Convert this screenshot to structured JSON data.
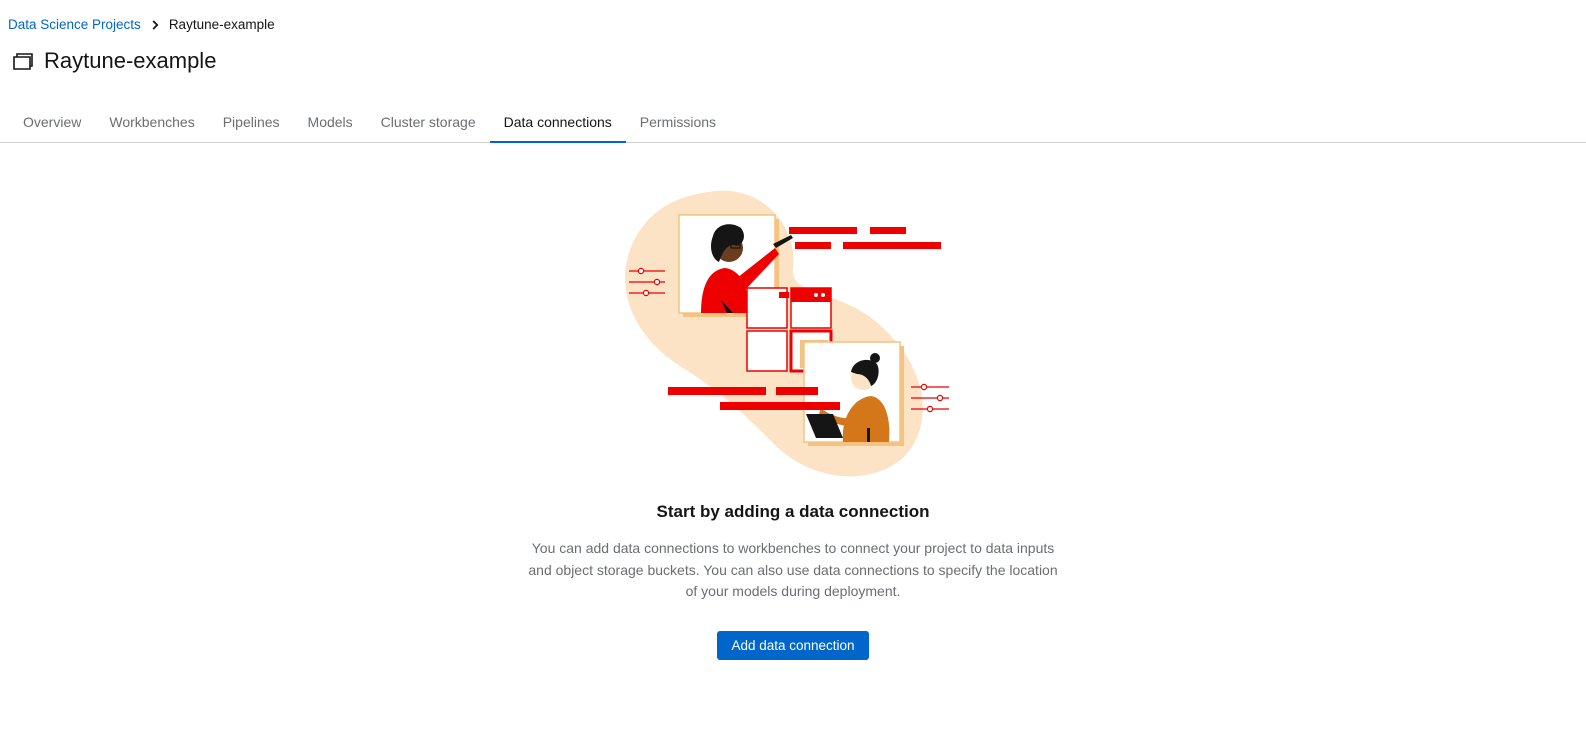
{
  "breadcrumb": {
    "parent": "Data Science Projects",
    "current": "Raytune-example"
  },
  "project": {
    "title": "Raytune-example",
    "icon": "project-icon"
  },
  "tabs": [
    {
      "label": "Overview",
      "active": false
    },
    {
      "label": "Workbenches",
      "active": false
    },
    {
      "label": "Pipelines",
      "active": false
    },
    {
      "label": "Models",
      "active": false
    },
    {
      "label": "Cluster storage",
      "active": false
    },
    {
      "label": "Data connections",
      "active": true
    },
    {
      "label": "Permissions",
      "active": false
    }
  ],
  "empty_state": {
    "title": "Start by adding a data connection",
    "body": "You can add data connections to workbenches to connect your project to data inputs and object storage buckets. You can also use data connections to specify the location of your models during deployment.",
    "button_label": "Add data connection",
    "illustration": "data-connection-illustration"
  },
  "colors": {
    "link": "#0066cc",
    "primary": "#0066cc",
    "accent_red": "#ee0000",
    "blob": "#fde3c6",
    "text_muted": "#6a6e73"
  }
}
